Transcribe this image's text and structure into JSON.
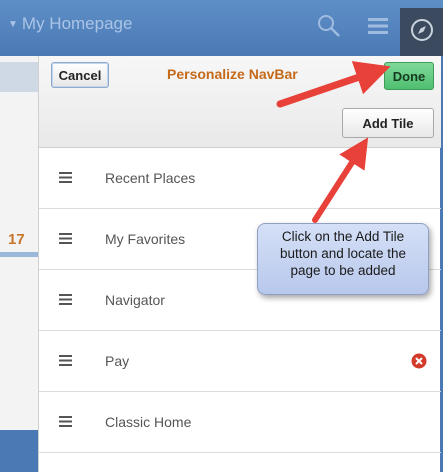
{
  "header": {
    "title": "My Homepage",
    "title_caret_icon": "caret-down-icon",
    "search_icon": "search-icon",
    "menu_icon": "hamburger-menu-icon",
    "navbar_icon": "compass-icon"
  },
  "background": {
    "left_number": "17"
  },
  "panel": {
    "cancel_label": "Cancel",
    "title": "Personalize NavBar",
    "done_label": "Done",
    "add_tile_label": "Add Tile"
  },
  "items": [
    {
      "label": "Recent Places",
      "removable": false
    },
    {
      "label": "My Favorites",
      "removable": false
    },
    {
      "label": "Navigator",
      "removable": false
    },
    {
      "label": "Pay",
      "removable": true
    },
    {
      "label": "Classic Home",
      "removable": false
    }
  ],
  "callout": {
    "line1": "Click on the Add Tile",
    "line2": "button and locate the",
    "line3": "page to be added"
  },
  "colors": {
    "header_blue": "#4a79b4",
    "title_orange": "#c56a1b",
    "done_green": "#4fbf70",
    "arrow_red": "#e8413a",
    "remove_red": "#d23a2a",
    "callout_blue": "#c6d4f2"
  }
}
